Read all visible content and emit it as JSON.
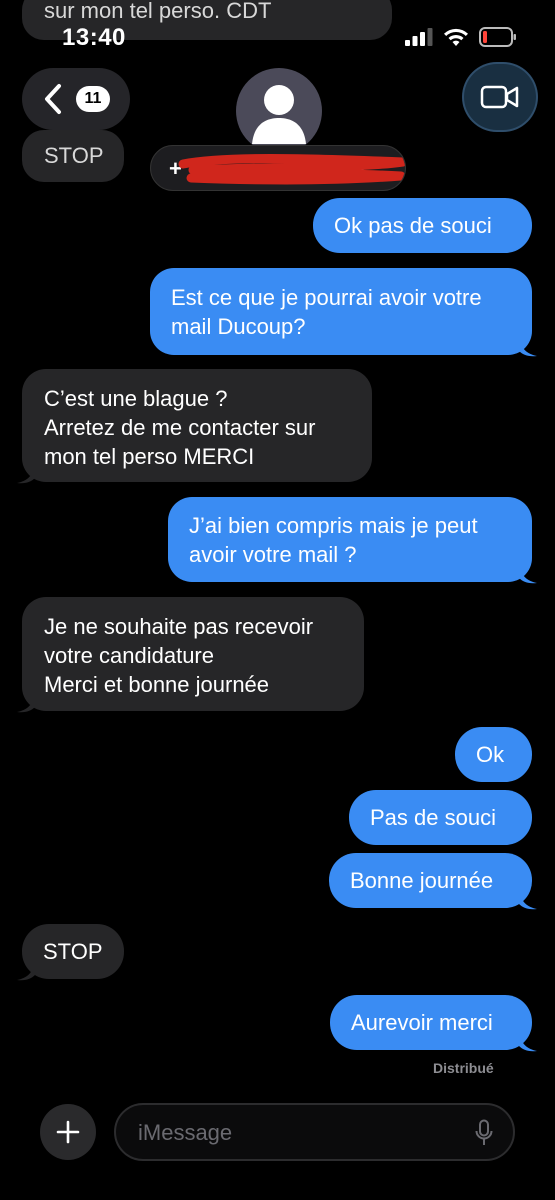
{
  "status_bar": {
    "time": "13:40"
  },
  "ghost_messages": [
    "sur mon tel perso. CDT",
    "STOP"
  ],
  "header": {
    "unread_count": "11",
    "contact_visible": "+",
    "contact_trailing": "7"
  },
  "messages": [
    {
      "from": "me",
      "text": "Ok pas de souci"
    },
    {
      "from": "me",
      "text": "Est ce que je pourrai avoir votre\nmail Ducoup?"
    },
    {
      "from": "them",
      "text": "C’est une blague ?\nArretez de me contacter sur\nmon tel perso MERCI"
    },
    {
      "from": "me",
      "text": "J’ai bien compris mais je peut\navoir votre mail ?"
    },
    {
      "from": "them",
      "text": "Je ne souhaite pas recevoir\nvotre candidature\nMerci et bonne journée"
    },
    {
      "from": "me",
      "text": "Ok"
    },
    {
      "from": "me",
      "text": "Pas de souci"
    },
    {
      "from": "me",
      "text": "Bonne journée"
    },
    {
      "from": "them",
      "text": "STOP"
    },
    {
      "from": "me",
      "text": "Aurevoir merci"
    }
  ],
  "delivery_status": "Distribué",
  "composer": {
    "placeholder": "iMessage"
  },
  "colors": {
    "outgoing": "#3a8cf3",
    "incoming": "#262628",
    "background": "#000000"
  }
}
